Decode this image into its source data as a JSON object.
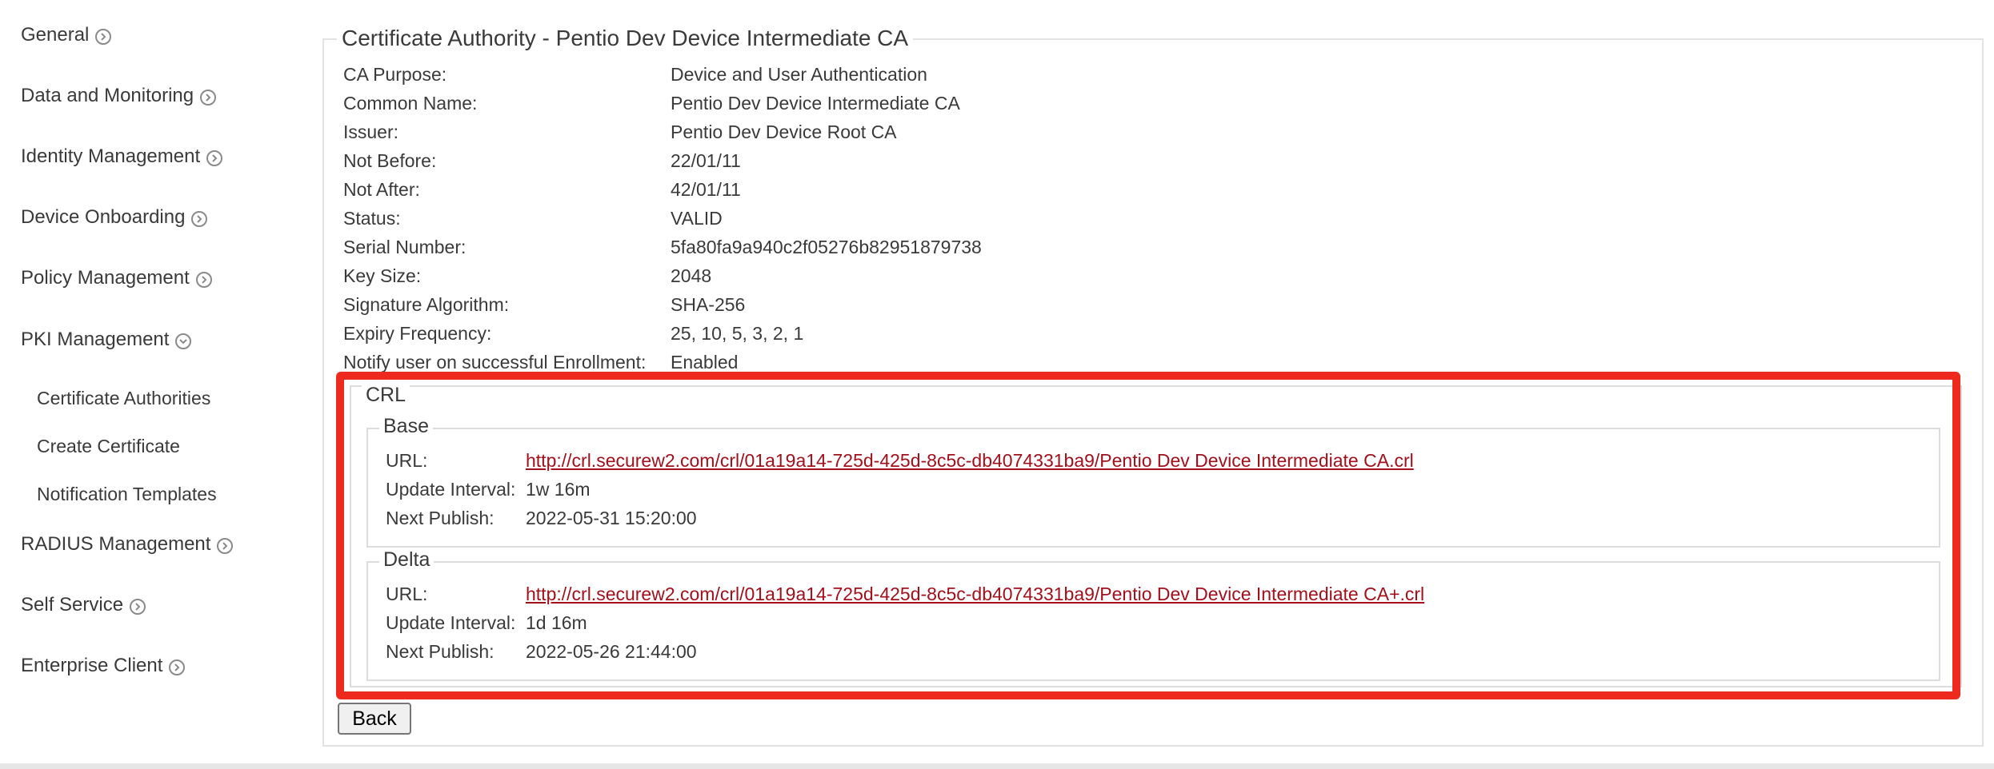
{
  "sidebar": {
    "items": [
      {
        "label": "General"
      },
      {
        "label": "Data and Monitoring"
      },
      {
        "label": "Identity Management"
      },
      {
        "label": "Device Onboarding"
      },
      {
        "label": "Policy Management"
      },
      {
        "label": "PKI Management"
      },
      {
        "label": "RADIUS Management"
      },
      {
        "label": "Self Service"
      },
      {
        "label": "Enterprise Client"
      }
    ],
    "pki_subitems": [
      {
        "label": "Certificate Authorities"
      },
      {
        "label": "Create Certificate"
      },
      {
        "label": "Notification Templates"
      }
    ]
  },
  "ca": {
    "title": "Certificate Authority - Pentio Dev Device Intermediate CA",
    "fields": [
      {
        "label": "CA Purpose:",
        "value": "Device and User Authentication"
      },
      {
        "label": "Common Name:",
        "value": "Pentio Dev Device Intermediate CA"
      },
      {
        "label": "Issuer:",
        "value": "Pentio Dev Device Root CA"
      },
      {
        "label": "Not Before:",
        "value": "22/01/11"
      },
      {
        "label": "Not After:",
        "value": "42/01/11"
      },
      {
        "label": "Status:",
        "value": "VALID"
      },
      {
        "label": "Serial Number:",
        "value": "5fa80fa9a940c2f05276b82951879738"
      },
      {
        "label": "Key Size:",
        "value": "2048"
      },
      {
        "label": "Signature Algorithm:",
        "value": "SHA-256"
      },
      {
        "label": "Expiry Frequency:",
        "value": "25, 10, 5, 3, 2, 1"
      },
      {
        "label": "Notify user on successful Enrollment:",
        "value": "Enabled"
      }
    ]
  },
  "crl": {
    "legend": "CRL",
    "base": {
      "legend": "Base",
      "url_label": "URL:",
      "url": "http://crl.securew2.com/crl/01a19a14-725d-425d-8c5c-db4074331ba9/Pentio Dev Device Intermediate CA.crl",
      "interval_label": "Update Interval:",
      "interval": "1w 16m",
      "publish_label": "Next Publish:",
      "publish": "2022-05-31 15:20:00"
    },
    "delta": {
      "legend": "Delta",
      "url_label": "URL:",
      "url": "http://crl.securew2.com/crl/01a19a14-725d-425d-8c5c-db4074331ba9/Pentio Dev Device Intermediate CA+.crl",
      "interval_label": "Update Interval:",
      "interval": "1d 16m",
      "publish_label": "Next Publish:",
      "publish": "2022-05-26 21:44:00"
    }
  },
  "buttons": {
    "back": "Back"
  },
  "colors": {
    "highlight": "#ee2a1e",
    "link": "#a2101c"
  }
}
